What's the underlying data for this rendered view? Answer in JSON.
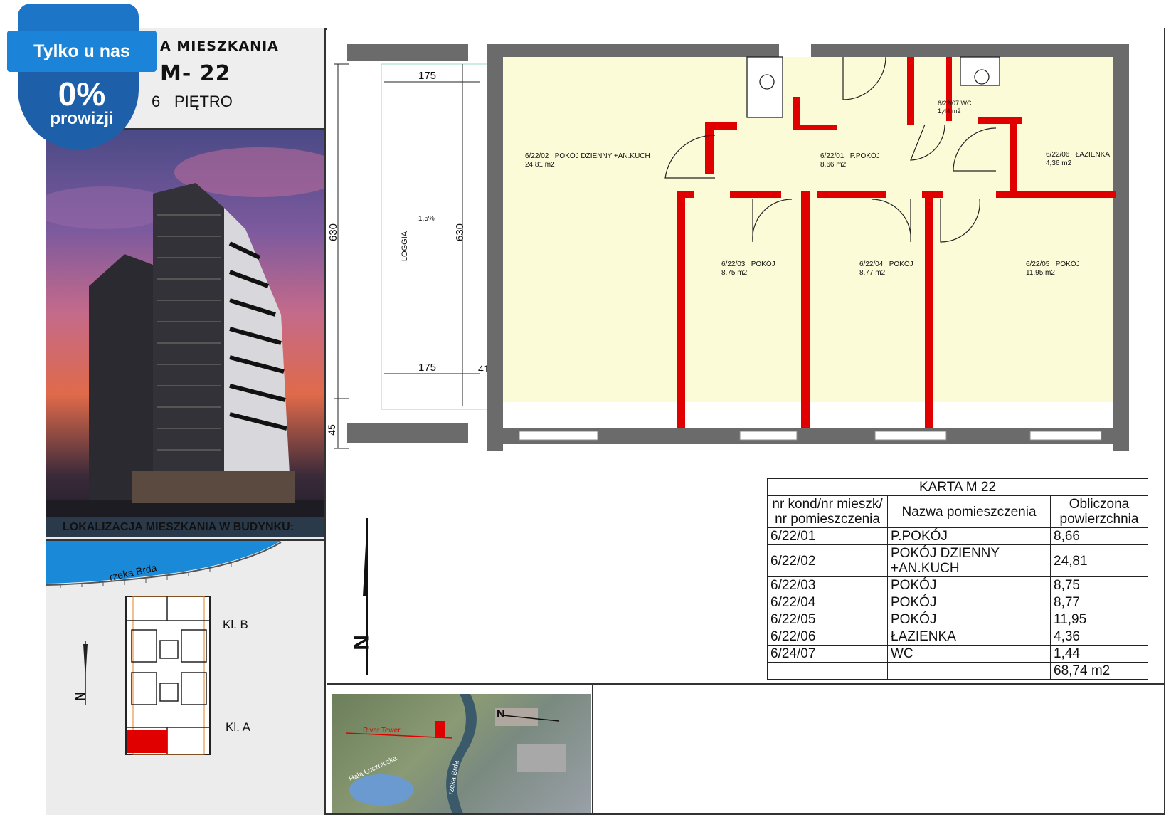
{
  "badge": {
    "line1": "Tylko u nas",
    "line2": "0%",
    "line3": "prowizji"
  },
  "header": {
    "title": "A MIESZKANIA",
    "unit": "M- 22",
    "floor_number": "6",
    "floor_label": "PIĘTRO"
  },
  "location": {
    "label": "LOKALIZACJA MIESZKANIA W BUDYNKU:",
    "river": "rzeka Brda",
    "stair_b": "Kl. B",
    "stair_a": "Kl. A",
    "north": "N"
  },
  "plan": {
    "loggia_label": "LOGGIA",
    "slope": "1,5%",
    "dims": {
      "top": "175",
      "bottom": "175",
      "left_h": "630",
      "inner_h": "630",
      "d41": "41",
      "d45": "45"
    },
    "rooms": [
      {
        "id": "6/22/02",
        "name": "POKÓJ DZIENNY +AN.KUCH",
        "area": "24,81 m2"
      },
      {
        "id": "6/22/01",
        "name": "P.POKÓJ",
        "area": "8,66 m2"
      },
      {
        "id": "6/22/07",
        "name": "WC",
        "area": "1,44 m2"
      },
      {
        "id": "6/22/06",
        "name": "ŁAZIENKA",
        "area": "4,36 m2"
      },
      {
        "id": "6/22/03",
        "name": "POKÓJ",
        "area": "8,75 m2"
      },
      {
        "id": "6/22/04",
        "name": "POKÓJ",
        "area": "8,77 m2"
      },
      {
        "id": "6/22/05",
        "name": "POKÓJ",
        "area": "11,95 m2"
      }
    ],
    "north": "N"
  },
  "karta": {
    "title": "KARTA M 22",
    "headers": [
      "nr kond/nr mieszk/ nr pomieszczenia",
      "Nazwa pomieszczenia",
      "Obliczona powierzchnia"
    ],
    "rows": [
      [
        "6/22/01",
        "P.POKÓJ",
        "8,66"
      ],
      [
        "6/22/02",
        "POKÓJ DZIENNY +AN.KUCH",
        "24,81"
      ],
      [
        "6/22/03",
        "POKÓJ",
        "8,75"
      ],
      [
        "6/22/04",
        "POKÓJ",
        "8,77"
      ],
      [
        "6/22/05",
        "POKÓJ",
        "11,95"
      ],
      [
        "6/22/06",
        "ŁAZIENKA",
        "4,36"
      ],
      [
        "6/24/07",
        "WC",
        "1,44"
      ]
    ],
    "total": "68,74 m2"
  },
  "aerial": {
    "river": "rzeka Brda",
    "north": "N",
    "tower": "River Tower",
    "arena": "Hala Łuczniczka"
  },
  "colors": {
    "room_fill": "#fbfbd8",
    "wall": "#6b6b6b",
    "partition": "#e00000",
    "badge": "#1d75c8"
  }
}
